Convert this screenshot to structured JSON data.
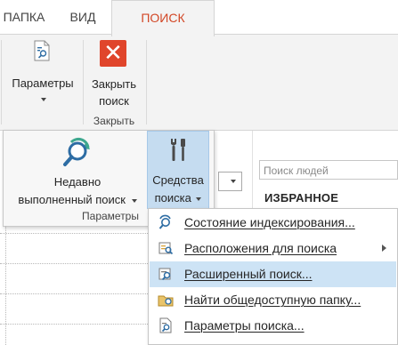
{
  "tabs": {
    "folder": "ПАПКА",
    "view": "ВИД",
    "search": "ПОИСК"
  },
  "ribbon": {
    "params_label": "Параметры",
    "close_label_1": "Закрыть",
    "close_label_2": "поиск",
    "close_group": "Закрыть"
  },
  "popup": {
    "recent_1": "Недавно",
    "recent_2": "выполненный поиск",
    "tools_1": "Средства",
    "tools_2": "поиска",
    "group_label": "Параметры"
  },
  "right": {
    "people_placeholder": "Поиск людей",
    "favorites": "ИЗБРАННОЕ"
  },
  "menu": {
    "items": [
      {
        "label": "Состояние индексирования...",
        "icon": "index-status-icon"
      },
      {
        "label": "Расположения для поиска",
        "icon": "search-locations-icon",
        "submenu": true
      },
      {
        "label": "Расширенный поиск...",
        "icon": "advanced-search-icon",
        "highlighted": true
      },
      {
        "label": "Найти общедоступную папку...",
        "icon": "public-folder-icon"
      },
      {
        "label": "Параметры поиска...",
        "icon": "search-options-icon"
      }
    ]
  },
  "colors": {
    "accent": "#d24726",
    "highlight": "#cde3f5",
    "close_red": "#e0452b",
    "icon_blue": "#2e6da4",
    "icon_teal": "#3fa88f"
  }
}
